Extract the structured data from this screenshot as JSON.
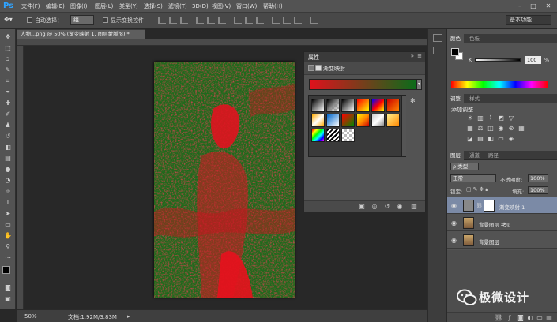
{
  "app": {
    "logo": "Ps"
  },
  "menu": [
    "文件(F)",
    "编辑(E)",
    "图像(I)",
    "图层(L)",
    "类型(Y)",
    "选择(S)",
    "滤镜(T)",
    "3D(D)",
    "视图(V)",
    "窗口(W)",
    "帮助(H)"
  ],
  "options": {
    "auto_select_label": "自动选择：",
    "auto_select_value": "组",
    "show_transform_label": "显示变换控件",
    "workspace": "基本功能"
  },
  "document": {
    "tab_title": "人物...png @ 50% (渐变映射 1, 图层蒙版/8) *",
    "zoom": "50%",
    "doc_info": "文档:1.92M/3.83M"
  },
  "properties": {
    "title": "属性",
    "subtitle": "渐变映射"
  },
  "color_panel": {
    "tabs": [
      "颜色",
      "色板"
    ],
    "k_label": "K",
    "k_value": "100",
    "k_unit": "%"
  },
  "adjustments_panel": {
    "tabs": [
      "调整",
      "样式"
    ],
    "title": "添加调整"
  },
  "layers_panel": {
    "tabs": [
      "图层",
      "通道",
      "路径"
    ],
    "filter_kind": "ρ 类型",
    "blend_mode": "正常",
    "opacity_label": "不透明度:",
    "opacity_value": "100%",
    "lock_label": "锁定:",
    "fill_label": "填充:",
    "fill_value": "100%",
    "layers": [
      {
        "name": "渐变映射 1",
        "selected": true
      },
      {
        "name": "背景图层 拷贝",
        "selected": false
      },
      {
        "name": "背景图层",
        "selected": false
      }
    ]
  },
  "watermark": {
    "text": "极微设计"
  },
  "colors": {
    "gradient_start": "#e0111c",
    "gradient_end": "#0d6b1a",
    "selection": "#7b8aa6"
  }
}
